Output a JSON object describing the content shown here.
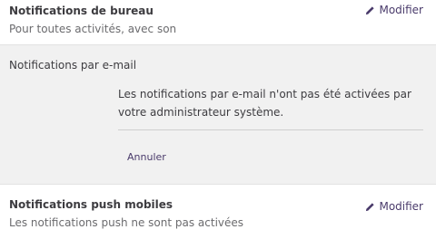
{
  "desktop": {
    "title": "Notifications de bureau",
    "description": "Pour toutes activités, avec son",
    "edit_label": "Modifier"
  },
  "email": {
    "title": "Notifications par e-mail",
    "message": "Les notifications par e-mail n'ont pas été activées par votre administrateur système.",
    "cancel_label": "Annuler"
  },
  "push": {
    "title": "Notifications push mobiles",
    "description": "Les notifications push ne sont pas activées",
    "edit_label": "Modifier"
  },
  "colors": {
    "accent": "#4a3b6b",
    "panel_bg": "#f1f1f1"
  },
  "icons": {
    "edit": "pencil-icon"
  }
}
